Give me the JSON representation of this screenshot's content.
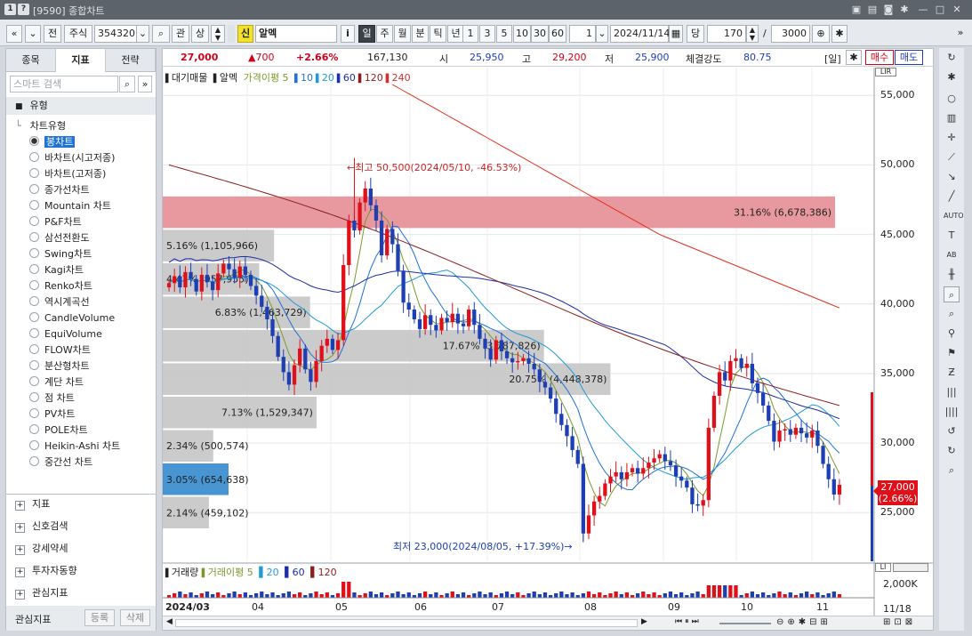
{
  "window": {
    "title": "[9590] 종합차트",
    "badge1": "1",
    "badge2": "?"
  },
  "toolbar": {
    "prev": "«",
    "dropdown": "»",
    "btn_jeon": "전",
    "market": "주식",
    "code": "354320",
    "search_icon": "search-icon",
    "gwan": "관",
    "sang": "상",
    "sin": "신",
    "name": "알멕",
    "info": "i",
    "periods": [
      "일",
      "주",
      "월",
      "분",
      "틱",
      "년"
    ],
    "active_period": "일",
    "intervals": [
      "1",
      "3",
      "5",
      "10",
      "30",
      "60"
    ],
    "count": "1",
    "date": "2024/11/14",
    "dang": "당",
    "bars": "170",
    "slash": "/",
    "total": "3000"
  },
  "left": {
    "tabs": [
      "종목",
      "지표",
      "전략"
    ],
    "active_tab": "지표",
    "search_placeholder": "스마트 검색",
    "section_type": "유형",
    "tree_root": "차트유형",
    "chart_types": [
      "봉차트",
      "바차트(시고저종)",
      "바차트(고저종)",
      "종가선차트",
      "Mountain 차트",
      "P&F차트",
      "삼선전환도",
      "Swing차트",
      "Kagi차트",
      "Renko차트",
      "역시계곡선",
      "CandleVolume",
      "EquiVolume",
      "FLOW차트",
      "분산형차트",
      "계단 차트",
      "점 차트",
      "PV차트",
      "POLE차트",
      "Heikin-Ashi 차트",
      "중간선 차트"
    ],
    "selected_type": "봉차트",
    "sections": [
      "지표",
      "신호검색",
      "강세약세",
      "투자자동향",
      "관심지표"
    ],
    "footer_label": "관심지표",
    "footer_add": "등록",
    "footer_del": "삭제"
  },
  "quote": {
    "price": "27,000",
    "change": "▲700",
    "rate": "+2.66%",
    "volume": "167,130",
    "open_label": "시",
    "open": "25,950",
    "high_label": "고",
    "high": "29,200",
    "low_label": "저",
    "low": "25,900",
    "strength_label": "체결강도",
    "strength": "80.75",
    "period_tag": "[일]",
    "buy": "매수",
    "sell": "매도"
  },
  "legend": {
    "title": "대기매물",
    "name": "알멕",
    "ma_label": "가격이평 5",
    "ma": [
      {
        "v": "10",
        "c": "#1f6fd6"
      },
      {
        "v": "20",
        "c": "#1f9ad6"
      },
      {
        "v": "60",
        "c": "#1c2ea8"
      },
      {
        "v": "120",
        "c": "#8b1c1c"
      },
      {
        "v": "240",
        "c": "#d62e2e"
      }
    ]
  },
  "vol_legend": {
    "title": "거래량",
    "ma_label": "거래이평 5",
    "ma": [
      "20",
      "60",
      "120"
    ]
  },
  "annotations": {
    "high": "←최고 50,500(2024/05/10, -46.53%)",
    "low": "최저 23,000(2024/08/05, +17.39%)→"
  },
  "price_tag": {
    "price": "27,000",
    "rate": "(2.66%)"
  },
  "vol_axis_label": "2,000K",
  "date_corner": "11/18",
  "chart_data": {
    "type": "candlestick",
    "y_ticks": [
      25000,
      30000,
      35000,
      40000,
      45000,
      50000,
      55000
    ],
    "y_tick_labels": [
      "25,000",
      "30,000",
      "35,000",
      "40,000",
      "45,000",
      "50,000",
      "55,000"
    ],
    "x_labels": [
      "2024/03",
      "04",
      "05",
      "06",
      "07",
      "08",
      "09",
      "10",
      "11"
    ],
    "volume_profile": [
      {
        "pct": "31.16%",
        "vol": "6,678,386",
        "from": 45400,
        "to": 47800,
        "highlight": "pink"
      },
      {
        "pct": "5.16%",
        "vol": "1,105,966",
        "from": 43000,
        "to": 45400
      },
      {
        "pct": "4.47%",
        "vol": "957,955",
        "from": 40600,
        "to": 43000
      },
      {
        "pct": "6.83%",
        "vol": "1,463,729",
        "from": 38200,
        "to": 40600
      },
      {
        "pct": "17.67%",
        "vol": "3,787,826",
        "from": 35800,
        "to": 38200
      },
      {
        "pct": "20.75%",
        "vol": "4,448,378",
        "from": 33400,
        "to": 35800
      },
      {
        "pct": "7.13%",
        "vol": "1,529,347",
        "from": 31000,
        "to": 33400
      },
      {
        "pct": "2.34%",
        "vol": "500,574",
        "from": 28600,
        "to": 31000
      },
      {
        "pct": "3.05%",
        "vol": "654,638",
        "from": 26200,
        "to": 28600,
        "highlight": "blue"
      },
      {
        "pct": "2.14%",
        "vol": "459,102",
        "from": 23800,
        "to": 26200
      }
    ],
    "closes": [
      41500,
      42000,
      41200,
      42300,
      41800,
      40900,
      42100,
      41600,
      41000,
      42200,
      42900,
      42500,
      41900,
      42700,
      42100,
      41300,
      40600,
      39800,
      38900,
      37700,
      36200,
      35100,
      34200,
      35600,
      36800,
      35300,
      34400,
      35900,
      37000,
      37500,
      36700,
      37400,
      42800,
      46000,
      45300,
      47300,
      48300,
      47100,
      46000,
      43500,
      45400,
      44300,
      42400,
      40100,
      39600,
      38900,
      38200,
      39200,
      38500,
      38100,
      39000,
      38700,
      39300,
      38600,
      38400,
      39600,
      38500,
      37500,
      36800,
      36000,
      37400,
      36600,
      36100,
      35800,
      35900,
      36100,
      35700,
      35300,
      34400,
      34000,
      33200,
      32100,
      31300,
      30500,
      29500,
      28500,
      23500,
      24800,
      25800,
      26200,
      27100,
      27600,
      27900,
      27400,
      27900,
      28200,
      27800,
      28200,
      28600,
      28900,
      29200,
      28700,
      28400,
      27600,
      27300,
      26800,
      25600,
      25500,
      25900,
      31100,
      33400,
      35100,
      34500,
      35900,
      36100,
      35400,
      35700,
      34300,
      33600,
      32700,
      31600,
      30100,
      30900,
      31000,
      30600,
      31100,
      30700,
      30400,
      30900,
      29800,
      28500,
      27400,
      26300,
      27000
    ],
    "volume_max_k": 2000,
    "price_range": [
      21500,
      57000
    ]
  }
}
